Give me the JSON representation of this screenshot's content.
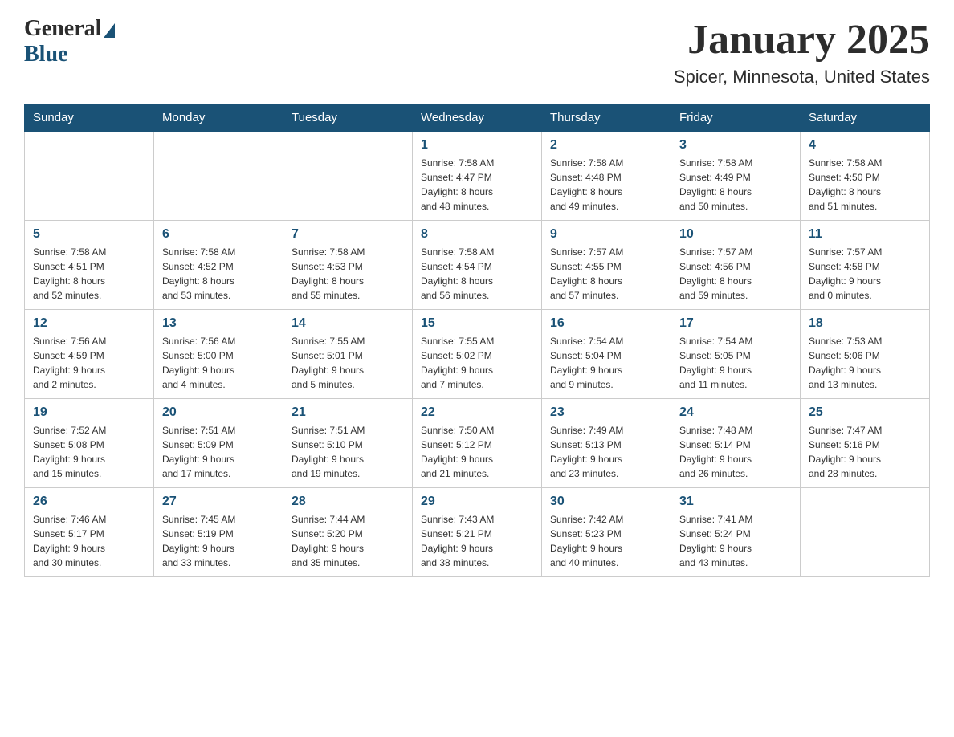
{
  "logo": {
    "general": "General",
    "blue": "Blue"
  },
  "title": "January 2025",
  "subtitle": "Spicer, Minnesota, United States",
  "days": [
    "Sunday",
    "Monday",
    "Tuesday",
    "Wednesday",
    "Thursday",
    "Friday",
    "Saturday"
  ],
  "weeks": [
    [
      {
        "day": "",
        "info": ""
      },
      {
        "day": "",
        "info": ""
      },
      {
        "day": "",
        "info": ""
      },
      {
        "day": "1",
        "info": "Sunrise: 7:58 AM\nSunset: 4:47 PM\nDaylight: 8 hours\nand 48 minutes."
      },
      {
        "day": "2",
        "info": "Sunrise: 7:58 AM\nSunset: 4:48 PM\nDaylight: 8 hours\nand 49 minutes."
      },
      {
        "day": "3",
        "info": "Sunrise: 7:58 AM\nSunset: 4:49 PM\nDaylight: 8 hours\nand 50 minutes."
      },
      {
        "day": "4",
        "info": "Sunrise: 7:58 AM\nSunset: 4:50 PM\nDaylight: 8 hours\nand 51 minutes."
      }
    ],
    [
      {
        "day": "5",
        "info": "Sunrise: 7:58 AM\nSunset: 4:51 PM\nDaylight: 8 hours\nand 52 minutes."
      },
      {
        "day": "6",
        "info": "Sunrise: 7:58 AM\nSunset: 4:52 PM\nDaylight: 8 hours\nand 53 minutes."
      },
      {
        "day": "7",
        "info": "Sunrise: 7:58 AM\nSunset: 4:53 PM\nDaylight: 8 hours\nand 55 minutes."
      },
      {
        "day": "8",
        "info": "Sunrise: 7:58 AM\nSunset: 4:54 PM\nDaylight: 8 hours\nand 56 minutes."
      },
      {
        "day": "9",
        "info": "Sunrise: 7:57 AM\nSunset: 4:55 PM\nDaylight: 8 hours\nand 57 minutes."
      },
      {
        "day": "10",
        "info": "Sunrise: 7:57 AM\nSunset: 4:56 PM\nDaylight: 8 hours\nand 59 minutes."
      },
      {
        "day": "11",
        "info": "Sunrise: 7:57 AM\nSunset: 4:58 PM\nDaylight: 9 hours\nand 0 minutes."
      }
    ],
    [
      {
        "day": "12",
        "info": "Sunrise: 7:56 AM\nSunset: 4:59 PM\nDaylight: 9 hours\nand 2 minutes."
      },
      {
        "day": "13",
        "info": "Sunrise: 7:56 AM\nSunset: 5:00 PM\nDaylight: 9 hours\nand 4 minutes."
      },
      {
        "day": "14",
        "info": "Sunrise: 7:55 AM\nSunset: 5:01 PM\nDaylight: 9 hours\nand 5 minutes."
      },
      {
        "day": "15",
        "info": "Sunrise: 7:55 AM\nSunset: 5:02 PM\nDaylight: 9 hours\nand 7 minutes."
      },
      {
        "day": "16",
        "info": "Sunrise: 7:54 AM\nSunset: 5:04 PM\nDaylight: 9 hours\nand 9 minutes."
      },
      {
        "day": "17",
        "info": "Sunrise: 7:54 AM\nSunset: 5:05 PM\nDaylight: 9 hours\nand 11 minutes."
      },
      {
        "day": "18",
        "info": "Sunrise: 7:53 AM\nSunset: 5:06 PM\nDaylight: 9 hours\nand 13 minutes."
      }
    ],
    [
      {
        "day": "19",
        "info": "Sunrise: 7:52 AM\nSunset: 5:08 PM\nDaylight: 9 hours\nand 15 minutes."
      },
      {
        "day": "20",
        "info": "Sunrise: 7:51 AM\nSunset: 5:09 PM\nDaylight: 9 hours\nand 17 minutes."
      },
      {
        "day": "21",
        "info": "Sunrise: 7:51 AM\nSunset: 5:10 PM\nDaylight: 9 hours\nand 19 minutes."
      },
      {
        "day": "22",
        "info": "Sunrise: 7:50 AM\nSunset: 5:12 PM\nDaylight: 9 hours\nand 21 minutes."
      },
      {
        "day": "23",
        "info": "Sunrise: 7:49 AM\nSunset: 5:13 PM\nDaylight: 9 hours\nand 23 minutes."
      },
      {
        "day": "24",
        "info": "Sunrise: 7:48 AM\nSunset: 5:14 PM\nDaylight: 9 hours\nand 26 minutes."
      },
      {
        "day": "25",
        "info": "Sunrise: 7:47 AM\nSunset: 5:16 PM\nDaylight: 9 hours\nand 28 minutes."
      }
    ],
    [
      {
        "day": "26",
        "info": "Sunrise: 7:46 AM\nSunset: 5:17 PM\nDaylight: 9 hours\nand 30 minutes."
      },
      {
        "day": "27",
        "info": "Sunrise: 7:45 AM\nSunset: 5:19 PM\nDaylight: 9 hours\nand 33 minutes."
      },
      {
        "day": "28",
        "info": "Sunrise: 7:44 AM\nSunset: 5:20 PM\nDaylight: 9 hours\nand 35 minutes."
      },
      {
        "day": "29",
        "info": "Sunrise: 7:43 AM\nSunset: 5:21 PM\nDaylight: 9 hours\nand 38 minutes."
      },
      {
        "day": "30",
        "info": "Sunrise: 7:42 AM\nSunset: 5:23 PM\nDaylight: 9 hours\nand 40 minutes."
      },
      {
        "day": "31",
        "info": "Sunrise: 7:41 AM\nSunset: 5:24 PM\nDaylight: 9 hours\nand 43 minutes."
      },
      {
        "day": "",
        "info": ""
      }
    ]
  ]
}
